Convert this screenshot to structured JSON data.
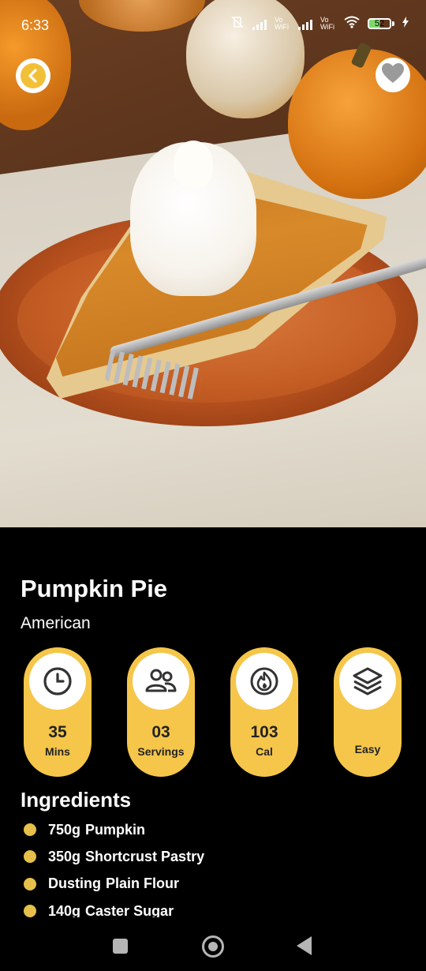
{
  "status_bar": {
    "time": "6:33",
    "network_label_1": "Vo WiFi",
    "network_label_2": "Vo WiFi",
    "battery": "52"
  },
  "header": {
    "back_icon": "chevron-left-icon",
    "favorite_icon": "heart-icon"
  },
  "recipe": {
    "title": "Pumpkin Pie",
    "cuisine": "American"
  },
  "stats": [
    {
      "icon": "clock-icon",
      "value": "35",
      "unit": "Mins"
    },
    {
      "icon": "users-icon",
      "value": "03",
      "unit": "Servings"
    },
    {
      "icon": "flame-icon",
      "value": "103",
      "unit": "Cal"
    },
    {
      "icon": "layers-icon",
      "value": "",
      "unit": "Easy"
    }
  ],
  "ingredients": {
    "heading": "Ingredients",
    "items": [
      {
        "qty": "750g",
        "name": "Pumpkin"
      },
      {
        "qty": "350g",
        "name": "Shortcrust Pastry"
      },
      {
        "qty": "Dusting",
        "name": "Plain Flour"
      },
      {
        "qty": "140g",
        "name": "Caster Sugar"
      }
    ]
  },
  "colors": {
    "accent": "#f5c64a",
    "bullet": "#e6c04a",
    "background": "#000000"
  }
}
